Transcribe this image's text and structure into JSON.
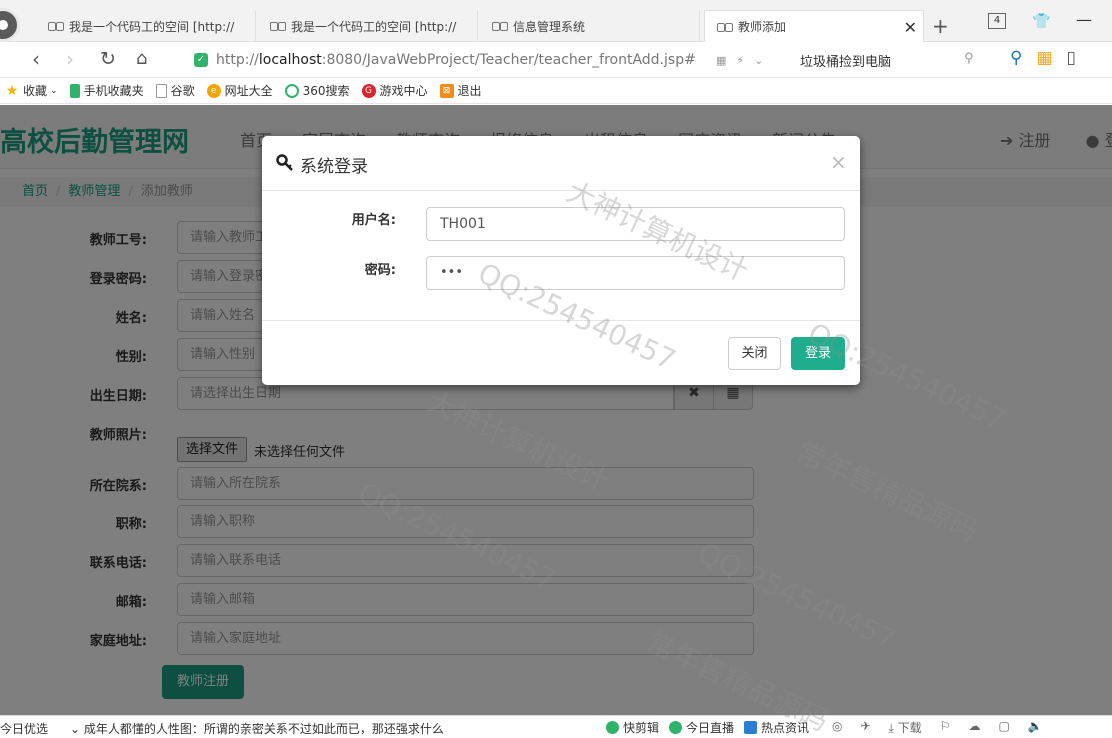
{
  "browser": {
    "tabs": [
      {
        "title": "我是一个代码工的空间 [http://",
        "active": false
      },
      {
        "title": "我是一个代码工的空间 [http://",
        "active": false
      },
      {
        "title": "信息管理系统",
        "active": false
      },
      {
        "title": "教师添加",
        "active": true
      }
    ],
    "tab_count": "4",
    "url_prefix": "http://",
    "url_host": "localhost",
    "url_rest": ":8080/JavaWebProject/Teacher/teacher_frontAdd.jsp#",
    "search_suggest": "垃圾桶捡到电脑",
    "bookmarks": [
      "收藏",
      "手机收藏夹",
      "谷歌",
      "网址大全",
      "360搜索",
      "游戏中心",
      "退出"
    ]
  },
  "site": {
    "logo": "高校后勤管理网",
    "nav": [
      "首页",
      "宿层查询",
      "教师查询",
      "报修信息",
      "出租信息",
      "网店资讯",
      "新闻公告"
    ],
    "register": "注册",
    "login_partial": "登"
  },
  "breadcrumb": {
    "home": "首页",
    "section": "教师管理",
    "current": "添加教师"
  },
  "form": {
    "rows": [
      {
        "label": "教师工号:",
        "placeholder": "请输入教师工号"
      },
      {
        "label": "登录密码:",
        "placeholder": "请输入登录密码"
      },
      {
        "label": "姓名:",
        "placeholder": "请输入姓名"
      },
      {
        "label": "性别:",
        "placeholder": "请输入性别"
      },
      {
        "label": "出生日期:",
        "placeholder": "请选择出生日期"
      },
      {
        "label": "教师照片:",
        "file_button": "选择文件",
        "file_status": "未选择任何文件"
      },
      {
        "label": "所在院系:",
        "placeholder": "请输入所在院系"
      },
      {
        "label": "职称:",
        "placeholder": "请输入职称"
      },
      {
        "label": "联系电话:",
        "placeholder": "请输入联系电话"
      },
      {
        "label": "邮箱:",
        "placeholder": "请输入邮箱"
      },
      {
        "label": "家庭地址:",
        "placeholder": "请输入家庭地址"
      }
    ],
    "submit": "教师注册"
  },
  "modal": {
    "title": "系统登录",
    "username_label": "用户名:",
    "username_value": "TH001",
    "password_label": "密码:",
    "password_value": "•••",
    "close_label": "关闭",
    "login_label": "登录"
  },
  "statusbar": {
    "left": "今日优选",
    "news": "成年人都懂的人性图：所谓的亲密关系不过如此而已，那还强求什么",
    "items": [
      "快剪辑",
      "今日直播",
      "热点资讯"
    ],
    "download": "下载"
  },
  "watermarks": [
    "QQ:254540457",
    "大神计算机设计",
    "常年售精品源码"
  ],
  "colors": {
    "brand": "#1b9f83",
    "login_button": "#1fae8d"
  }
}
